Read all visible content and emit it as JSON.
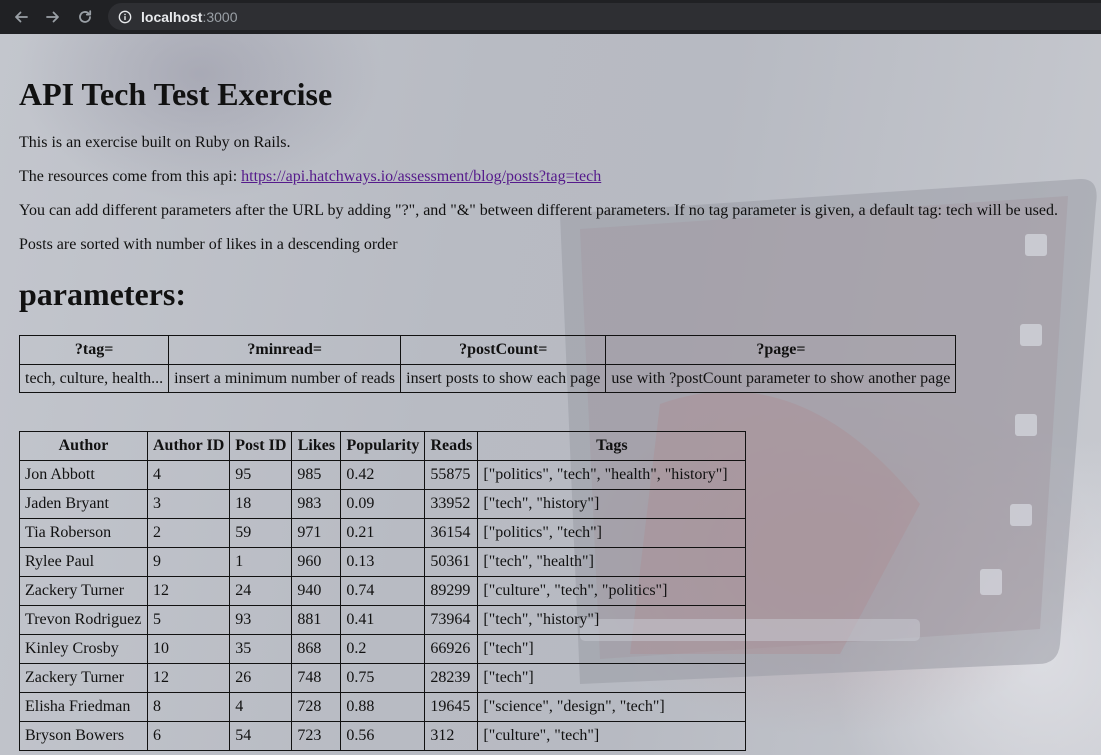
{
  "browser": {
    "back_icon": "arrow-left-icon",
    "forward_icon": "arrow-right-icon",
    "reload_icon": "reload-icon",
    "info_icon": "info-icon",
    "url_host": "localhost",
    "url_port": ":3000"
  },
  "page": {
    "title": "API Tech Test Exercise",
    "intro": "This is an exercise built on Ruby on Rails.",
    "resources_prefix": "The resources come from this api: ",
    "api_link": "https://api.hatchways.io/assessment/blog/posts?tag=tech",
    "parameters_note": "You can add different parameters after the URL by adding \"?\", and \"&\" between different parameters. If no tag parameter is given, a default tag: tech will be used.",
    "sort_note": "Posts are sorted with number of likes in a descending order",
    "parameters_heading": "parameters:"
  },
  "param_table": {
    "headers": [
      "?tag=",
      "?minread=",
      "?postCount=",
      "?page="
    ],
    "row": [
      "tech, culture, health...",
      "insert a minimum number of reads",
      "insert posts to show each page",
      "use with ?postCount parameter to show another page"
    ]
  },
  "posts_table": {
    "headers": [
      "Author",
      "Author ID",
      "Post ID",
      "Likes",
      "Popularity",
      "Reads",
      "Tags"
    ],
    "rows": [
      [
        "Jon Abbott",
        "4",
        "95",
        "985",
        "0.42",
        "55875",
        "[\"politics\", \"tech\", \"health\", \"history\"]"
      ],
      [
        "Jaden Bryant",
        "3",
        "18",
        "983",
        "0.09",
        "33952",
        "[\"tech\", \"history\"]"
      ],
      [
        "Tia Roberson",
        "2",
        "59",
        "971",
        "0.21",
        "36154",
        "[\"politics\", \"tech\"]"
      ],
      [
        "Rylee Paul",
        "9",
        "1",
        "960",
        "0.13",
        "50361",
        "[\"tech\", \"health\"]"
      ],
      [
        "Zackery Turner",
        "12",
        "24",
        "940",
        "0.74",
        "89299",
        "[\"culture\", \"tech\", \"politics\"]"
      ],
      [
        "Trevon Rodriguez",
        "5",
        "93",
        "881",
        "0.41",
        "73964",
        "[\"tech\", \"history\"]"
      ],
      [
        "Kinley Crosby",
        "10",
        "35",
        "868",
        "0.2",
        "66926",
        "[\"tech\"]"
      ],
      [
        "Zackery Turner",
        "12",
        "26",
        "748",
        "0.75",
        "28239",
        "[\"tech\"]"
      ],
      [
        "Elisha Friedman",
        "8",
        "4",
        "728",
        "0.88",
        "19645",
        "[\"science\", \"design\", \"tech\"]"
      ],
      [
        "Bryson Bowers",
        "6",
        "54",
        "723",
        "0.56",
        "312",
        "[\"culture\", \"tech\"]"
      ]
    ]
  }
}
